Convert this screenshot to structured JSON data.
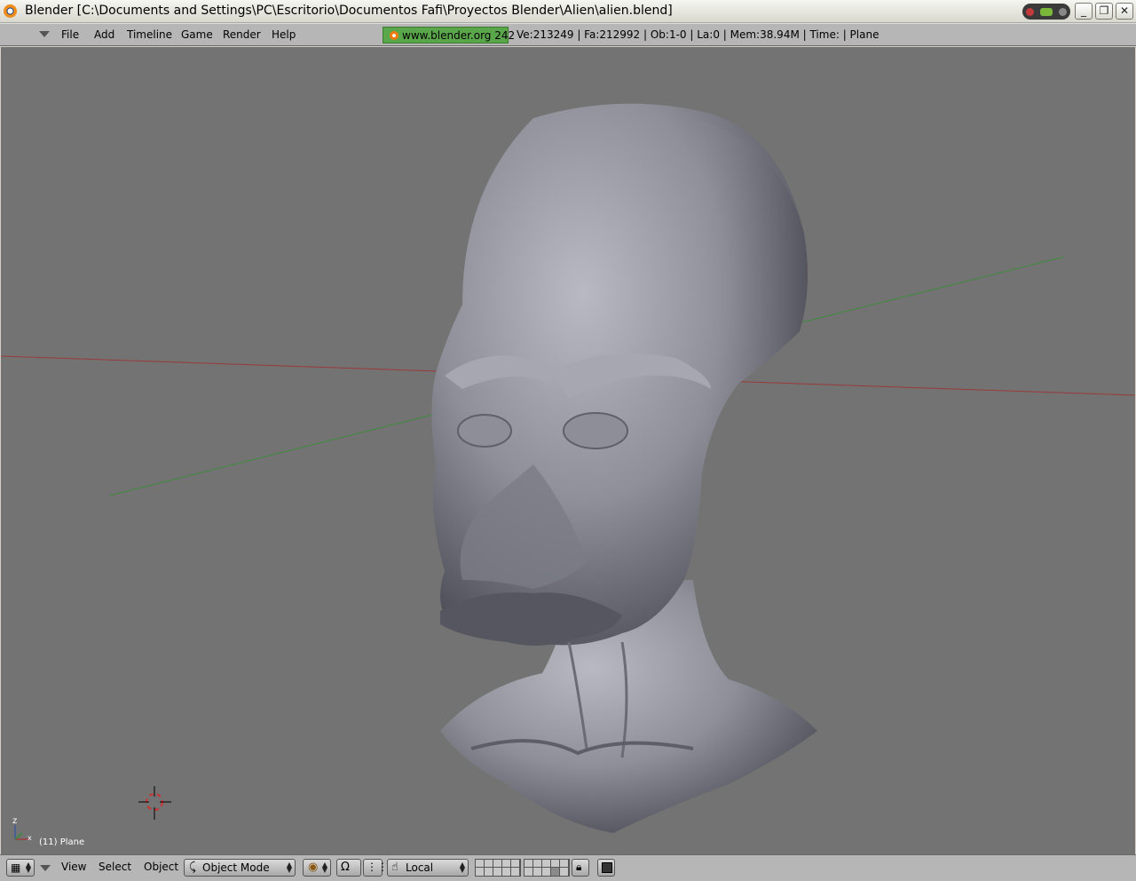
{
  "window": {
    "title": "Blender [C:\\Documents and Settings\\PC\\Escritorio\\Documentos Fafi\\Proyectos Blender\\Alien\\alien.blend]",
    "controls": {
      "minimize": "_",
      "restore": "❐",
      "close": "✕"
    }
  },
  "menubar": {
    "items": [
      "File",
      "Add",
      "Timeline",
      "Game",
      "Render",
      "Help"
    ],
    "site_badge": "www.blender.org 242",
    "stats": "Ve:213249 | Fa:212992 | Ob:1-0 | La:0  | Mem:38.94M  | Time: | Plane"
  },
  "viewport": {
    "object_label": "(11) Plane",
    "axis_z": "z",
    "axis_x": "x",
    "background_color": "#737373",
    "x_axis_color": "#9a3a3a",
    "y_axis_color": "#3f8a3f"
  },
  "bottombar": {
    "menus": [
      "View",
      "Select",
      "Object"
    ],
    "mode_select": "Object Mode",
    "orientation_select": "Local",
    "icons": [
      "grid-editor-type-icon",
      "shading-solid-icon",
      "pivot-icon",
      "snap-icon",
      "hand-transform-icon",
      "layer-grid-icon",
      "lock-icon",
      "render-preview-icon"
    ]
  }
}
